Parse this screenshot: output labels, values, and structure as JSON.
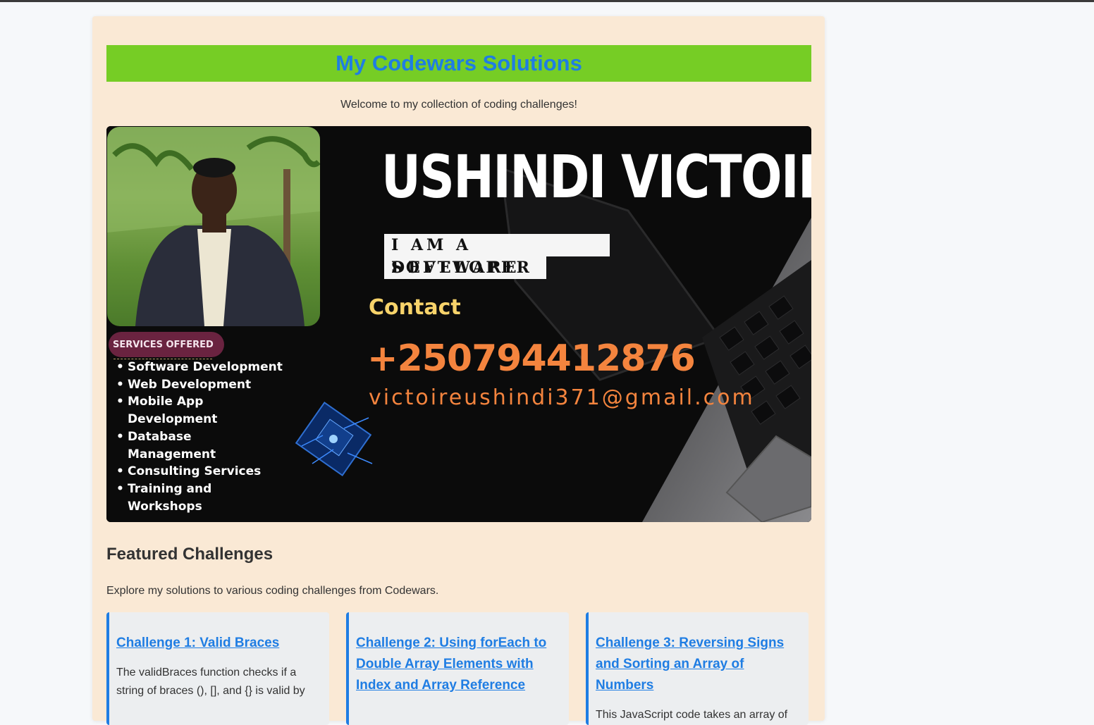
{
  "page": {
    "title": "My Codewars Solutions",
    "welcome": "Welcome to my collection of coding challenges!"
  },
  "banner": {
    "name": "USHINDI VICTOIRE",
    "role_line1": "I AM A SOFTWARE",
    "role_line2": "DEVELOPER",
    "contact_label": "Contact",
    "phone": "+250794412876",
    "email": "victoireushindi371@gmail.com",
    "services_label": "SERVICES OFFERED",
    "services": [
      "Software Development",
      "Web Development",
      "Mobile App Development",
      "Database Management",
      "Consulting Services",
      "Training and Workshops"
    ]
  },
  "featured": {
    "title": "Featured Challenges",
    "description": "Explore my solutions to various coding challenges from Codewars."
  },
  "challenges": [
    {
      "title": "Challenge 1: Valid Braces",
      "description": "The validBraces function checks if a string of braces (), [], and {} is valid by"
    },
    {
      "title": "Challenge 2: Using forEach to Double Array Elements with Index and Array Reference",
      "description": ""
    },
    {
      "title": "Challenge 3: Reversing Signs and Sorting an Array of Numbers",
      "description": "This JavaScript code takes an array of"
    }
  ],
  "colors": {
    "title_bar": "#76cd25",
    "title_text": "#1f7de3",
    "page_panel": "#fae9d5",
    "card_accent": "#1f7de3",
    "banner_phone": "#f4843e",
    "banner_contact": "#f7d36a",
    "services_pill": "#6a2340"
  }
}
